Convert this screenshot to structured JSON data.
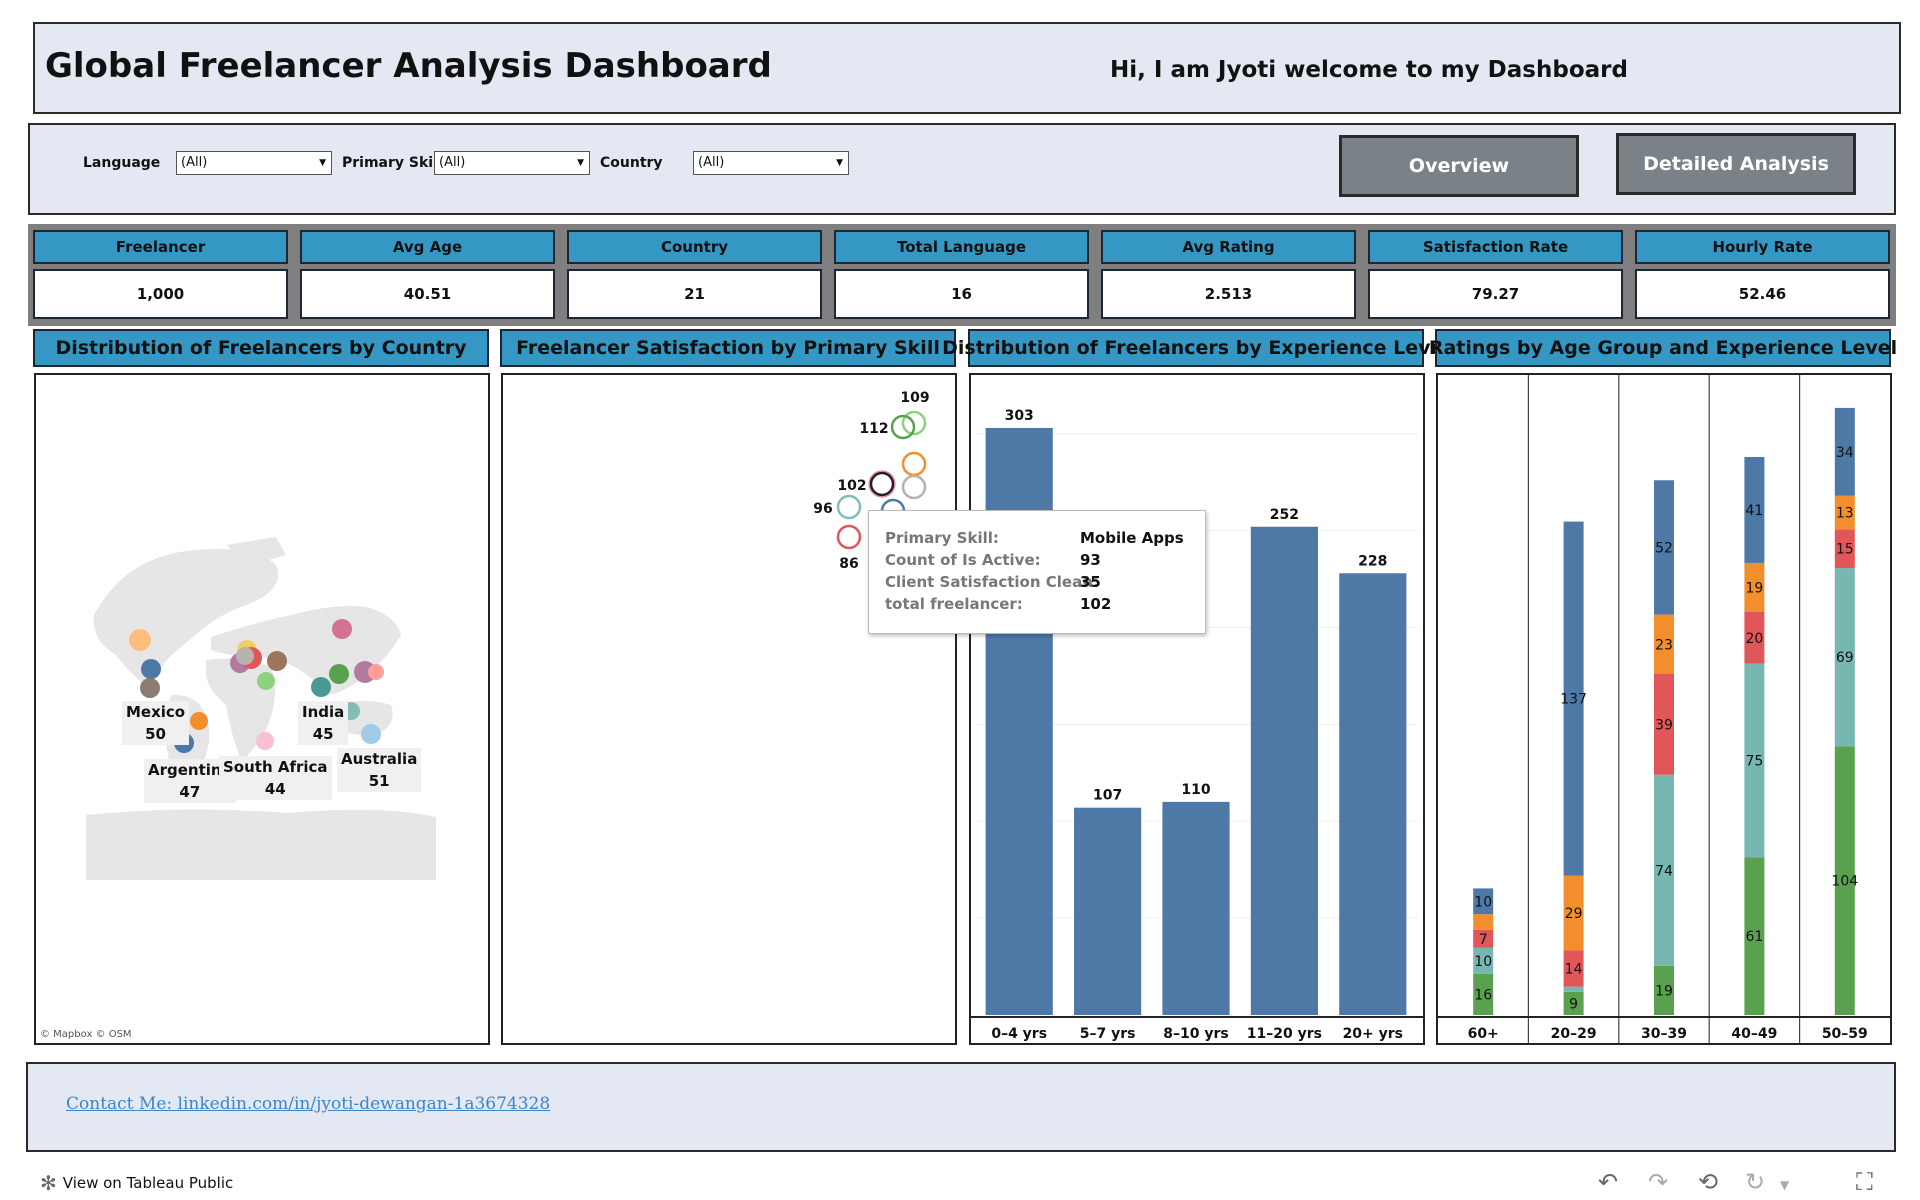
{
  "header": {
    "title": "Global Freelancer Analysis Dashboard",
    "greeting": "Hi, I am Jyoti welcome to my Dashboard"
  },
  "filters": [
    {
      "label": "Language",
      "value": "(All)"
    },
    {
      "label": "Primary Skill",
      "value": "(All)"
    },
    {
      "label": "Country",
      "value": "(All)"
    }
  ],
  "nav_buttons": {
    "overview": "Overview",
    "detailed": "Detailed Analysis"
  },
  "kpis": [
    {
      "label": "Freelancer",
      "value": "1,000"
    },
    {
      "label": "Avg Age",
      "value": "40.51"
    },
    {
      "label": "Country",
      "value": "21"
    },
    {
      "label": "Total Language",
      "value": "16"
    },
    {
      "label": "Avg Rating",
      "value": "2.513"
    },
    {
      "label": "Satisfaction Rate",
      "value": "79.27"
    },
    {
      "label": "Hourly Rate",
      "value": "52.46"
    }
  ],
  "panels": {
    "map_title": "Distribution of Freelancers by Country",
    "satisfaction_title": "Freelancer Satisfaction by Primary Skill",
    "experience_title": "Distribution of Freelancers by Experience Level",
    "ratings_title": "Ratings by Age Group and Experience Level"
  },
  "map": {
    "credit": "© Mapbox  © OSM",
    "labels": [
      {
        "country": "Mexico",
        "count": "50"
      },
      {
        "country": "India",
        "count": "45"
      },
      {
        "country": "Argentina",
        "count": "47"
      },
      {
        "country": "South Africa",
        "count": "44"
      },
      {
        "country": "Australia",
        "count": "51"
      }
    ]
  },
  "tooltip": {
    "rows": [
      {
        "key": "Primary Skill:",
        "value": "Mobile Apps"
      },
      {
        "key": "Count of Is Active:",
        "value": "93"
      },
      {
        "key": "Client Satisfaction Clean:",
        "value": "35"
      },
      {
        "key": "total freelancer:",
        "value": "102"
      }
    ]
  },
  "contact": {
    "link": "Contact Me: linkedin.com/in/jyoti-dewangan-1a3674328"
  },
  "footer": {
    "view_label": "View on Tableau Public"
  },
  "colors": {
    "accent": "#3598c4",
    "panel_bg": "#e3e8f2",
    "bar": "#4e79a7",
    "stack": [
      "#59a14f",
      "#76b7b2",
      "#e15759",
      "#f28e2b",
      "#4e79a7"
    ]
  },
  "chart_data": [
    {
      "type": "scatter",
      "title": "Freelancer Satisfaction by Primary Skill",
      "labels": [
        "109",
        "112",
        "102",
        "96",
        "86"
      ]
    },
    {
      "type": "bar",
      "title": "Distribution of Freelancers by Experience Level",
      "categories": [
        "0–4 yrs",
        "5–7 yrs",
        "8–10 yrs",
        "11–20 yrs",
        "20+ yrs"
      ],
      "values": [
        303,
        107,
        110,
        252,
        228
      ],
      "ylim": [
        0,
        320
      ]
    },
    {
      "type": "bar",
      "title": "Ratings by Age Group and Experience Level",
      "categories": [
        "60+",
        "20–29",
        "30–39",
        "40–49",
        "50–59"
      ],
      "series": [
        {
          "values": [
            16,
            9,
            19,
            61,
            104
          ]
        },
        {
          "values": [
            10,
            2,
            74,
            75,
            69
          ]
        },
        {
          "values": [
            7,
            14,
            39,
            20,
            15
          ]
        },
        {
          "values": [
            6,
            29,
            23,
            19,
            13
          ]
        },
        {
          "values": [
            10,
            137,
            52,
            41,
            34
          ]
        }
      ],
      "ylim": [
        0,
        240
      ]
    }
  ]
}
